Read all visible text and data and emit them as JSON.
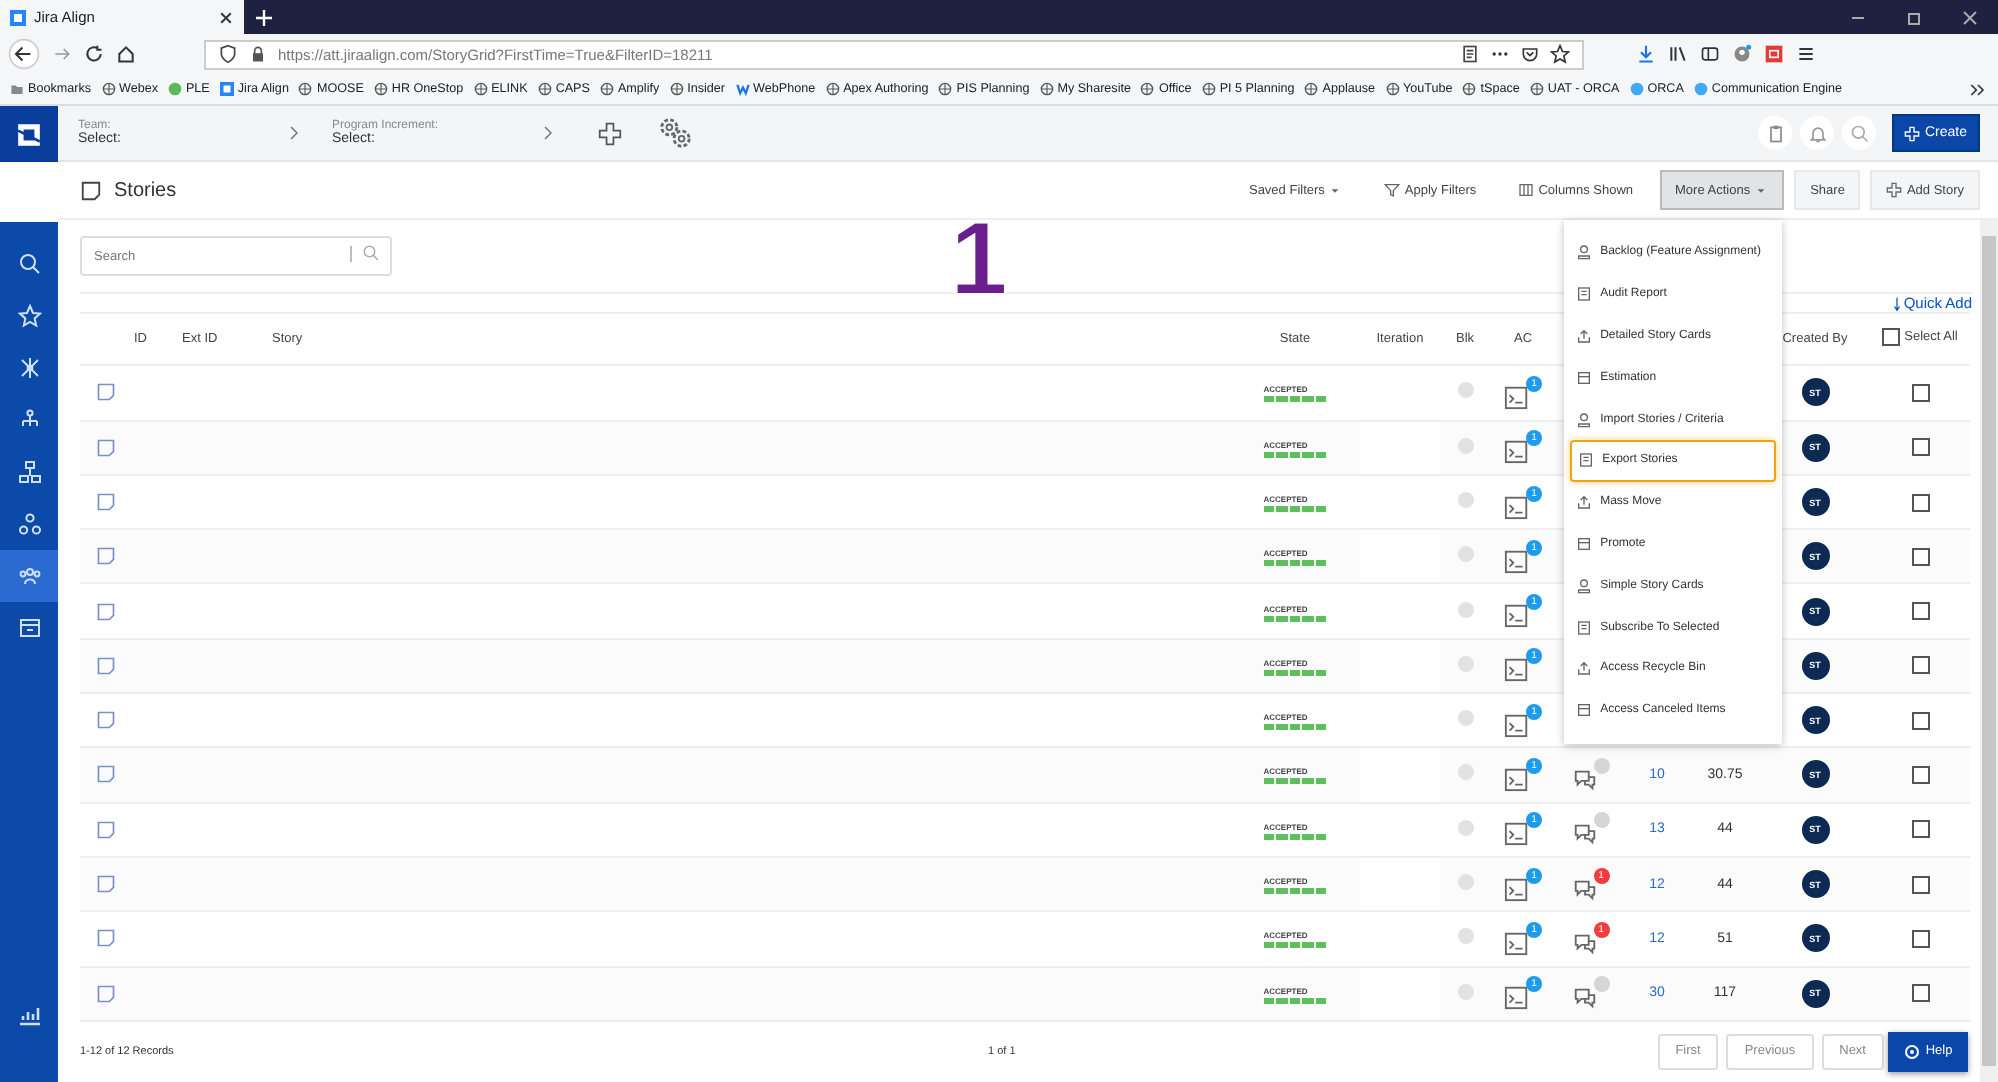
{
  "browser": {
    "tab_title": "Jira Align",
    "url": "https://att.jiraalign.com/StoryGrid?FirstTime=True&FilterID=18211",
    "bookmarks": [
      "Bookmarks",
      "Webex",
      "PLE",
      "Jira Align",
      "MOOSE",
      "HR OneStop",
      "ELINK",
      "CAPS",
      "Amplify",
      "Insider",
      "WebPhone",
      "Apex Authoring",
      "PIS Planning",
      "My Sharesite",
      "Office",
      "PI 5 Planning",
      "Applause",
      "YouTube",
      "tSpace",
      "UAT - ORCA",
      "ORCA",
      "Communication Engine"
    ]
  },
  "sidebar": {
    "items": [
      {
        "selected": false
      },
      {
        "selected": false
      },
      {
        "selected": false
      },
      {
        "selected": false
      },
      {
        "selected": false
      },
      {
        "selected": false
      },
      {
        "selected": true
      },
      {
        "selected": false
      }
    ]
  },
  "header": {
    "team_label": "Team:",
    "team_value": "Select:",
    "pi_label": "Program Increment:",
    "pi_value": "Select:",
    "create_button": "Create"
  },
  "page": {
    "title": "Stories",
    "toolbar": [
      {
        "label": "Saved Filters",
        "kind": "dropdown",
        "selected": false
      },
      {
        "label": "Apply Filters",
        "kind": "filter",
        "selected": false
      },
      {
        "label": "Columns Shown",
        "kind": "columns",
        "selected": false
      },
      {
        "label": "More Actions",
        "kind": "dropdown",
        "selected": true
      },
      {
        "label": "Share",
        "kind": "plain",
        "selected": false
      },
      {
        "label": "Add Story",
        "kind": "add",
        "selected": false
      }
    ]
  },
  "search": {
    "placeholder": "Search"
  },
  "annotation": "1",
  "more_actions_menu": [
    {
      "label": "Backlog (Feature Assignment)",
      "selected": false
    },
    {
      "label": "Audit Report",
      "selected": false
    },
    {
      "label": "Detailed Story Cards",
      "selected": false
    },
    {
      "label": "Estimation",
      "selected": false
    },
    {
      "label": "Import Stories / Criteria",
      "selected": false
    },
    {
      "label": "Export Stories",
      "selected": true
    },
    {
      "label": "Mass Move",
      "selected": false
    },
    {
      "label": "Promote",
      "selected": false
    },
    {
      "label": "Simple Story Cards",
      "selected": false
    },
    {
      "label": "Subscribe To Selected",
      "selected": false
    },
    {
      "label": "Access Recycle Bin",
      "selected": false
    },
    {
      "label": "Access Canceled Items",
      "selected": false
    }
  ],
  "table": {
    "quick_add": "Quick Add",
    "columns": [
      "ID",
      "Ext ID",
      "Story",
      "State",
      "Iteration",
      "Blk",
      "AC",
      "Created By"
    ],
    "select_all": {
      "label": "Select All",
      "checked": false
    },
    "rows": [
      {
        "state": "ACCEPTED",
        "ac": "1",
        "created_by": "ST",
        "checked": false
      },
      {
        "state": "ACCEPTED",
        "ac": "1",
        "created_by": "ST",
        "checked": false
      },
      {
        "state": "ACCEPTED",
        "ac": "1",
        "created_by": "ST",
        "checked": false
      },
      {
        "state": "ACCEPTED",
        "ac": "1",
        "created_by": "ST",
        "checked": false
      },
      {
        "state": "ACCEPTED",
        "ac": "1",
        "created_by": "ST",
        "checked": false
      },
      {
        "state": "ACCEPTED",
        "ac": "1",
        "created_by": "ST",
        "checked": false
      },
      {
        "state": "ACCEPTED",
        "ac": "1",
        "created_by": "ST",
        "checked": false
      },
      {
        "state": "ACCEPTED",
        "ac": "1",
        "comments": {
          "alert": false
        },
        "column_11": "10",
        "column_12": "30.75",
        "created_by": "ST",
        "checked": false
      },
      {
        "state": "ACCEPTED",
        "ac": "1",
        "comments": {
          "alert": false
        },
        "column_11": "13",
        "column_12": "44",
        "created_by": "ST",
        "checked": false
      },
      {
        "state": "ACCEPTED",
        "ac": "1",
        "comments": {
          "alert": true,
          "count": "1"
        },
        "column_11": "12",
        "column_12": "44",
        "created_by": "ST",
        "checked": false
      },
      {
        "state": "ACCEPTED",
        "ac": "1",
        "comments": {
          "alert": true,
          "count": "1"
        },
        "column_11": "12",
        "column_12": "51",
        "created_by": "ST",
        "checked": false
      },
      {
        "state": "ACCEPTED",
        "ac": "1",
        "comments": {
          "alert": false
        },
        "column_11": "30",
        "column_12": "117",
        "created_by": "ST",
        "checked": false
      }
    ]
  },
  "footer": {
    "records": "1-12 of 12 Records",
    "page": "1 of 1",
    "buttons": [
      "First",
      "Previous",
      "Next"
    ],
    "help_button": "Help"
  }
}
